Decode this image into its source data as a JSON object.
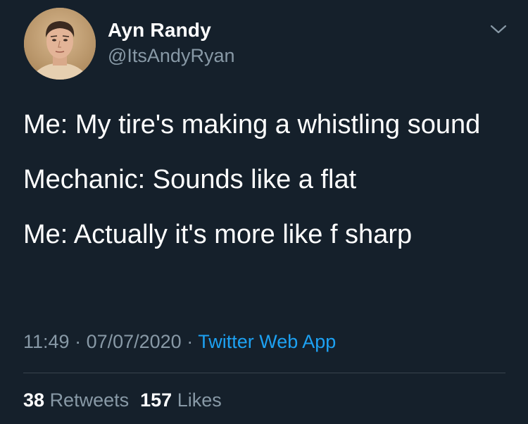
{
  "author": {
    "display_name": "Ayn Randy",
    "handle": "@ItsAndyRyan"
  },
  "tweet": {
    "paragraphs": [
      "Me: My tire's making a whistling sound",
      "Mechanic: Sounds like a flat",
      "Me: Actually it's more like f sharp"
    ]
  },
  "meta": {
    "time": "11:49",
    "separator": " · ",
    "date": "07/07/2020",
    "source": "Twitter Web App"
  },
  "stats": {
    "retweets_count": "38",
    "retweets_label": "Retweets",
    "likes_count": "157",
    "likes_label": "Likes"
  },
  "icons": {
    "menu": "chevron-down-icon",
    "avatar": "avatar"
  },
  "colors": {
    "background": "#15202b",
    "secondary_text": "#8899a6",
    "link": "#1da1f2",
    "divider": "#38444d"
  }
}
